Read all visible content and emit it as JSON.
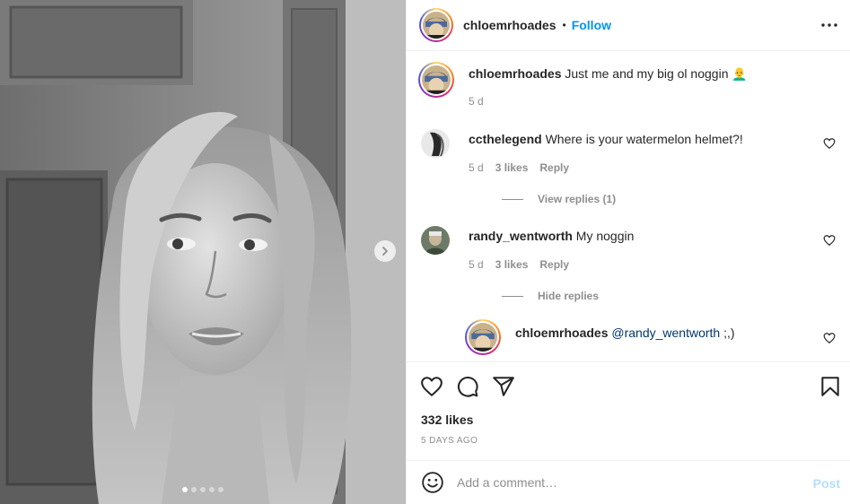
{
  "post": {
    "author": "chloemrhoades",
    "follow_label": "Follow",
    "separator": "•",
    "caption": {
      "username": "chloemrhoades",
      "text": "Just me and my big ol noggin 👨‍🦲",
      "time": "5 d"
    },
    "likes": "332 likes",
    "posted_ago": "5 DAYS AGO",
    "carousel": {
      "total": 5,
      "active_index": 0
    }
  },
  "comments": [
    {
      "username": "ccthelegend",
      "text": "Where is your watermelon helmet?!",
      "time": "5 d",
      "likes": "3 likes",
      "reply_label": "Reply",
      "replies_toggle": "View replies (1)"
    },
    {
      "username": "randy_wentworth",
      "text": "My noggin",
      "time": "5 d",
      "likes": "3 likes",
      "reply_label": "Reply",
      "replies_toggle": "Hide replies"
    }
  ],
  "reply": {
    "username": "chloemrhoades",
    "mention": "@randy_wentworth",
    "text": " ;,)"
  },
  "composer": {
    "placeholder": "Add a comment…",
    "post_label": "Post"
  },
  "icons": {
    "more": "more-horizontal-icon",
    "like": "heart-icon",
    "comment": "speech-bubble-icon",
    "share": "paper-plane-icon",
    "save": "bookmark-icon",
    "emoji": "smiley-icon",
    "next": "chevron-right-icon"
  },
  "colors": {
    "accent": "#0095f6",
    "post_disabled": "#b2dffc",
    "muted": "#8e8e8e",
    "text": "#262626",
    "mention": "#00376b"
  }
}
